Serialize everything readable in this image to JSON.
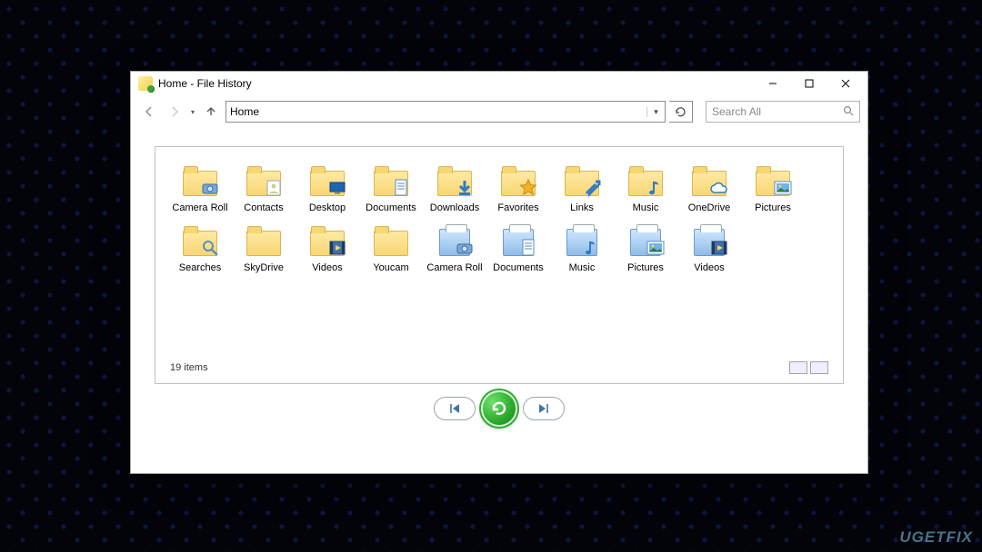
{
  "window": {
    "title": "Home - File History"
  },
  "nav": {
    "address": "Home",
    "search_placeholder": "Search All"
  },
  "items": [
    {
      "label": "Camera Roll",
      "kind": "folder",
      "overlay": "camera"
    },
    {
      "label": "Contacts",
      "kind": "folder",
      "overlay": "contact"
    },
    {
      "label": "Desktop",
      "kind": "folder",
      "overlay": "desktop"
    },
    {
      "label": "Documents",
      "kind": "folder",
      "overlay": "doc"
    },
    {
      "label": "Downloads",
      "kind": "folder",
      "overlay": "download"
    },
    {
      "label": "Favorites",
      "kind": "folder",
      "overlay": "star"
    },
    {
      "label": "Links",
      "kind": "folder",
      "overlay": "link"
    },
    {
      "label": "Music",
      "kind": "folder",
      "overlay": "music"
    },
    {
      "label": "OneDrive",
      "kind": "folder",
      "overlay": "cloud"
    },
    {
      "label": "Pictures",
      "kind": "folder",
      "overlay": "picture"
    },
    {
      "label": "Searches",
      "kind": "folder",
      "overlay": "search"
    },
    {
      "label": "SkyDrive",
      "kind": "folder",
      "overlay": ""
    },
    {
      "label": "Videos",
      "kind": "folder",
      "overlay": "video"
    },
    {
      "label": "Youcam",
      "kind": "folder",
      "overlay": ""
    },
    {
      "label": "Camera Roll",
      "kind": "library",
      "overlay": "camera"
    },
    {
      "label": "Documents",
      "kind": "library",
      "overlay": "doc"
    },
    {
      "label": "Music",
      "kind": "library",
      "overlay": "music"
    },
    {
      "label": "Pictures",
      "kind": "library",
      "overlay": "picture"
    },
    {
      "label": "Videos",
      "kind": "library",
      "overlay": "video"
    }
  ],
  "status": {
    "count_text": "19 items"
  },
  "watermark": "UG⁠ETFIX"
}
